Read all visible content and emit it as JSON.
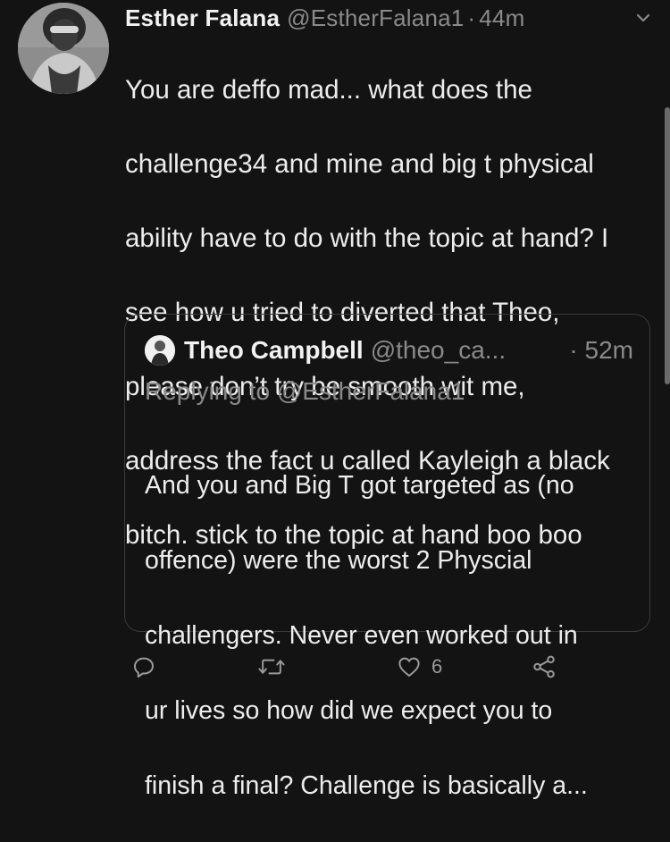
{
  "tweet": {
    "author_name": "Esther Falana",
    "author_handle": "@EstherFalana1",
    "separator": "·",
    "time": "44m",
    "text_lines": [
      "You are deffo mad... what does the",
      "challenge34 and mine and big t physical",
      "ability have to do with the topic at hand? I",
      "see how u tried to diverted that Theo,",
      "please don’t try be smooth wit me,",
      "address the fact u called Kayleigh a black",
      "bitch. stick to the topic at hand boo boo"
    ]
  },
  "quoted_tweet": {
    "author_name": "Theo Campbell",
    "author_handle": "@theo_ca...",
    "time": "· 52m",
    "replying_to": "Replying to @EstherFalana1",
    "text_lines": [
      "And you and Big T got targeted as (no",
      "offence) were the worst 2 Physcial",
      "challengers. Never even worked out in",
      "ur lives so how did we expect you to",
      "finish a final? Challenge is basically a..."
    ]
  },
  "actions": {
    "reply_icon": "reply-icon",
    "retweet_icon": "retweet-icon",
    "like_icon": "heart-icon",
    "like_count": "6",
    "share_icon": "share-icon"
  },
  "colors": {
    "background": "#131313",
    "text": "#ededed",
    "muted": "#8a8a8a",
    "border": "#3a3a3a"
  }
}
